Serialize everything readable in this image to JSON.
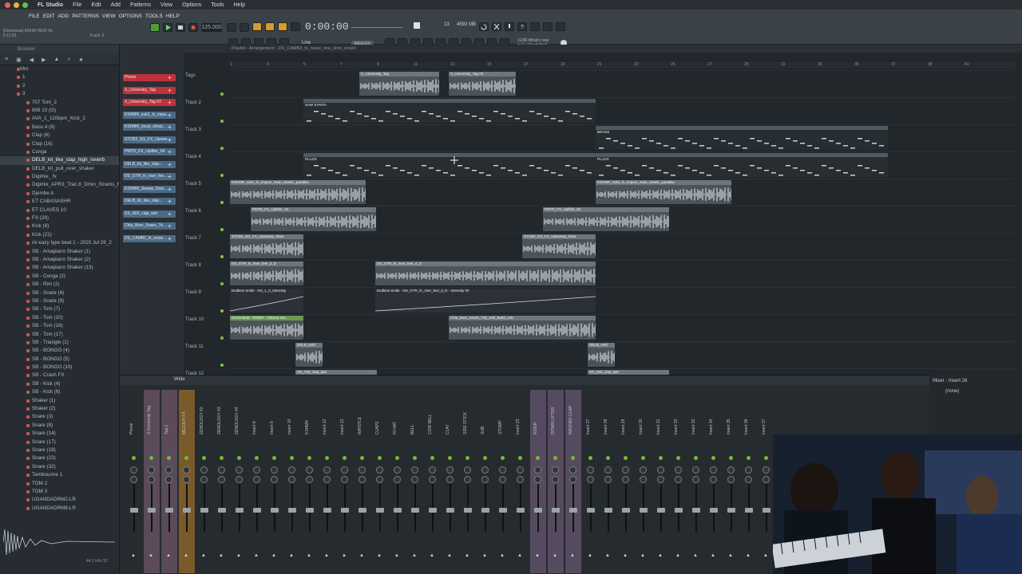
{
  "app": {
    "name": "FL Studio",
    "mac_menu": [
      "File",
      "Edit",
      "Add",
      "Patterns",
      "View",
      "Options",
      "Tools",
      "Help"
    ],
    "fl_menu": [
      "FILE",
      "EDIT",
      "ADD",
      "PATTERNS",
      "VIEW",
      "OPTIONS",
      "TOOLS",
      "HELP"
    ]
  },
  "transport": {
    "tempo": "125.000",
    "time": "0:00:00",
    "pattern": "Track 3",
    "hint_title": "[Downbeat] MIAMI HEAT flp",
    "hint_time": "6:11:06",
    "snap": "Line",
    "instrument": "BRASS",
    "cpu": "13",
    "mem": "4592 MB",
    "cloud_line1": "11/06 What's new",
    "cloud_line2": "in FL Cloud Pro?"
  },
  "browser": {
    "title": "Browser",
    "root": "Afro",
    "folders": [
      "1",
      "2",
      "3"
    ],
    "items": [
      "707 Tom_2",
      "808 10 (G)",
      "AVA_1_110bpm_Kick_2",
      "Bass 4 (8)",
      "Clap (6)",
      "Clap (16)",
      "Conga",
      "DELB_kit_like_clap_high_reverb",
      "DELB_kit_pull_over_shaker",
      "Digimix_ fx",
      "Digimix_APR3_Trac.8_Dmin_Strams_Fx",
      "Djembe A",
      "ET CABASASHR",
      "ET CLAVES 10",
      "FX (28)",
      "Kick (8)",
      "Kick (21)",
      "mi eazy type beat 1 - 2020 Jul 29_2",
      "SB - Amapiano Shaker (1)",
      "SB - Amapiano Shaker (2)",
      "SB - Amapiano Shaker (13)",
      "SB - Conga (2)",
      "SB - Rim (2)",
      "SB - Snare (6)",
      "SB - Snare (9)",
      "SB - Tom (7)",
      "SB - Tom (10)",
      "SB - Tom (16)",
      "SB - Tom (17)",
      "SB - Triangle (1)",
      "SB - BONGO (4)",
      "SB - BONGO (5)",
      "SB - BONGO (10)",
      "SB - Crash FX",
      "SB - Kick (4)",
      "SB - Kick (6)",
      "Shaker (1)",
      "Shaker (2)",
      "Snare (3)",
      "Snare (8)",
      "Snare (14)",
      "Snare (17)",
      "Snare (18)",
      "Snare (22)",
      "Snare (32)",
      "Tambourine 1",
      "TOM 2",
      "TOM 3",
      "UGANDADRM2-LR",
      "UGANDADRM8-LR"
    ],
    "selected_index": 7,
    "footer_left": "44.1 kHz 32"
  },
  "channels": [
    {
      "label": "Phone",
      "color": "red"
    },
    {
      "label": "X_University_Tag",
      "color": "red"
    },
    {
      "label": "X_University_Tag #2",
      "color": "red"
    },
    {
      "label": "KSHMR_sub1_fx_impa...",
      "color": "blue"
    },
    {
      "label": "KSHMR_vocal_shout...",
      "color": "blue"
    },
    {
      "label": "STCB2_SG_FX_Upswe...",
      "color": "blue"
    },
    {
      "label": "PMTD_FX_Uplifter_04",
      "color": "blue"
    },
    {
      "label": "DELB_kit_like_clap...",
      "color": "blue"
    },
    {
      "label": "DS_GTR_fx_riser_fee...",
      "color": "blue"
    },
    {
      "label": "KSHMR_Sweep_Dow...",
      "color": "blue"
    },
    {
      "label": "DELB_kit_like_clap...",
      "color": "blue"
    },
    {
      "label": "SS_A02_clap_wet",
      "color": "blue"
    },
    {
      "label": "Chla_Boer_Snare_Tri...",
      "color": "blue"
    },
    {
      "label": "DS_CAMB2_fx_noise...",
      "color": "blue"
    }
  ],
  "playlist": {
    "title": "Playlist - Arrangement - DS_CAMB2_fx_noise_one_shot_crowd",
    "ruler": [
      "1",
      "3",
      "5",
      "7",
      "9",
      "11",
      "13",
      "15",
      "17",
      "19",
      "21",
      "23",
      "25",
      "27",
      "29",
      "31",
      "33",
      "35",
      "37",
      "39",
      "41"
    ],
    "tracks": [
      "Tags",
      "Track 2",
      "Track 3",
      "Track 4",
      "Track 5",
      "Track 6",
      "Track 7",
      "Track 8",
      "Track 9",
      "Track 10",
      "Track 11",
      "Track 12"
    ],
    "clips": [
      {
        "track": 0,
        "label": "X_University_Tag",
        "kind": "audio"
      },
      {
        "track": 0,
        "label": "X_University_Tag #2",
        "kind": "audio"
      },
      {
        "track": 1,
        "label": "SAW SYNTH",
        "kind": "pat"
      },
      {
        "track": 2,
        "label": "BRASS",
        "kind": "pat"
      },
      {
        "track": 3,
        "label": "PLUCK",
        "kind": "pat"
      },
      {
        "track": 3,
        "label": "PLUCK",
        "kind": "pat"
      },
      {
        "track": 4,
        "label": "KSHMR_sub1_fx_impact_main_classic_parallax",
        "kind": "audio"
      },
      {
        "track": 4,
        "label": "KSHMR_sub1_fx_impact_main_classic_parallax",
        "kind": "audio"
      },
      {
        "track": 5,
        "label": "PMTD_FX_Uplifter_04",
        "kind": "audio"
      },
      {
        "track": 5,
        "label": "PMTD_FX_Uplifter_04",
        "kind": "audio"
      },
      {
        "track": 6,
        "label": "STCB2_SG_FX_Upsweep_Slow",
        "kind": "audio"
      },
      {
        "track": 6,
        "label": "STCB2_SG_FX_Upsweep_Slow",
        "kind": "audio"
      },
      {
        "track": 7,
        "label": "DS_GTR_fx_riser_feel_d_D",
        "kind": "audio"
      },
      {
        "track": 7,
        "label": "DS_GTR_fx_riser_feel_d_D",
        "kind": "audio"
      },
      {
        "track": 8,
        "label": "Endless Smile - DS_1_0_Intensity",
        "kind": "auto"
      },
      {
        "track": 8,
        "label": "Endless Smile - DS_GTR_fx_riser_feel_d_D - Intensity #2",
        "kind": "auto"
      },
      {
        "track": 9,
        "label": "Gross Beat - RISER - Volume env",
        "kind": "green"
      },
      {
        "track": 9,
        "label": "Chla_Boer_Snare_Trip_wild_Build_128",
        "kind": "audio"
      },
      {
        "track": 10,
        "label": "DELB_verb",
        "kind": "audio"
      },
      {
        "track": 10,
        "label": "DELB_verb",
        "kind": "audio"
      },
      {
        "track": 11,
        "label": "SS_A02_clap_wet",
        "kind": "audio"
      },
      {
        "track": 11,
        "label": "SS_A02_clap_wet",
        "kind": "audio"
      }
    ]
  },
  "mixer": {
    "title": "Mixer - Insert 26",
    "layout": "Wide",
    "route": "(none)",
    "strips": [
      "Phone",
      "X University Tag",
      "Tag 2",
      "MELODY FX",
      "ZENOLOGY #2",
      "ZENOLOGY #3",
      "ZENOLOGY #4",
      "Insert 8",
      "Insert 9",
      "Insert 10",
      "KSHMR",
      "Insert 12",
      "Insert 13",
      "WHISTLE",
      "CLAPS",
      "HI HAT",
      "BELL",
      "COW BELL",
      "CLAY",
      "SIDE STICK",
      "SUB",
      "STOMP",
      "Insert 23",
      "RISER",
      "DOWN LIFTER",
      "WASHED CLAP",
      "Insert 27",
      "Insert 28",
      "Insert 29",
      "Insert 30",
      "Insert 31",
      "Insert 32",
      "Insert 33",
      "Insert 34",
      "Insert 35",
      "Insert 36",
      "Insert 37"
    ],
    "selected_insert": "26"
  }
}
